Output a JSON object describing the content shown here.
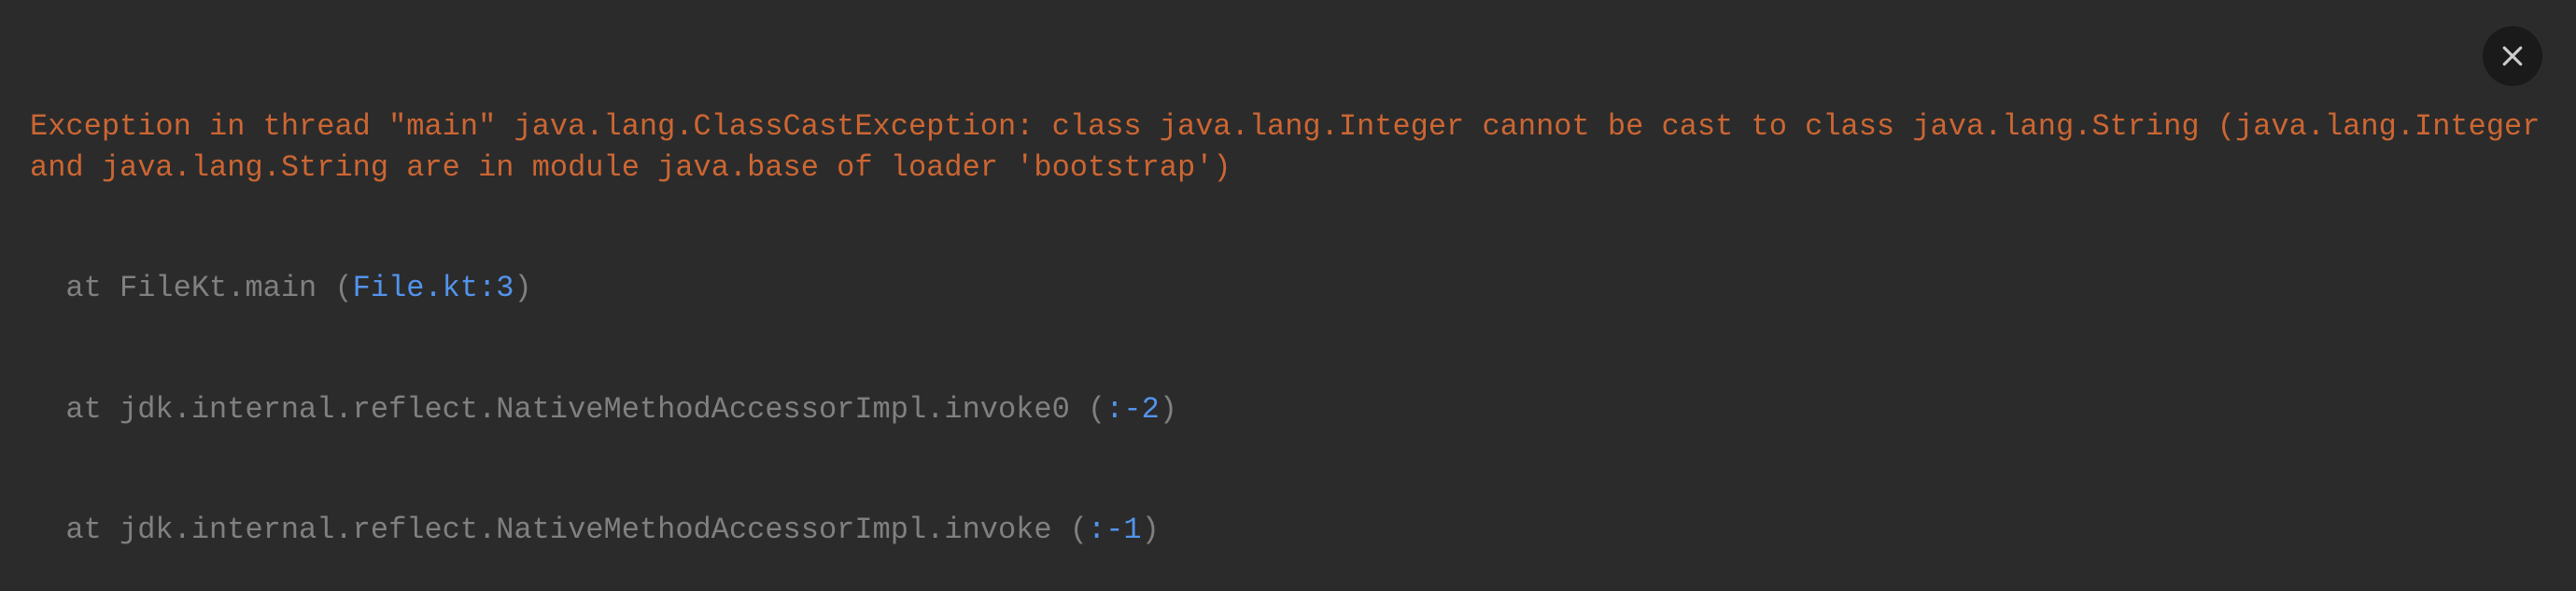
{
  "console": {
    "exception_header": "Exception in thread \"main\" java.lang.ClassCastException: class java.lang.Integer cannot be cast to class java.lang.String (java.lang.Integer and java.lang.String are in module java.base of loader 'bootstrap')",
    "stack": [
      {
        "prefix": "at FileKt.main ",
        "paren_open": "(",
        "link": "File.kt:3",
        "paren_close": ")"
      },
      {
        "prefix": "at jdk.internal.reflect.NativeMethodAccessorImpl.invoke0 ",
        "paren_open": "(",
        "link": ":-2",
        "paren_close": ")"
      },
      {
        "prefix": "at jdk.internal.reflect.NativeMethodAccessorImpl.invoke ",
        "paren_open": "(",
        "link": ":-1",
        "paren_close": ")"
      }
    ]
  }
}
